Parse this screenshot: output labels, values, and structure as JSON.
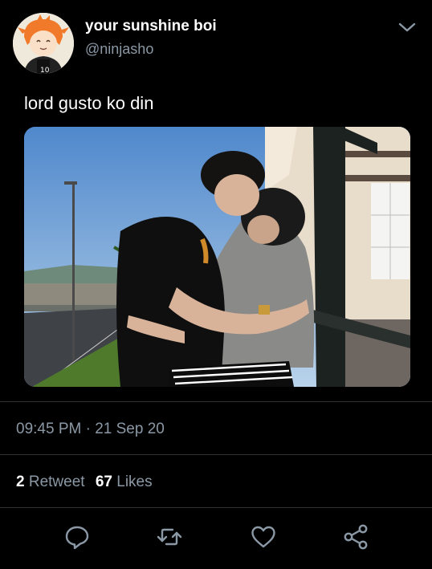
{
  "tweet": {
    "display_name": "your sunshine boi",
    "handle": "@ninjasho",
    "text": "lord gusto ko din",
    "timestamp": "09:45 PM · 21 Sep 20",
    "retweets": {
      "count": "2",
      "label": "Retweet"
    },
    "likes": {
      "count": "67",
      "label": "Likes"
    }
  },
  "icons": {
    "menu": "chevron-down-icon",
    "reply": "reply-icon",
    "retweet": "retweet-icon",
    "like": "heart-icon",
    "share": "share-icon"
  },
  "colors": {
    "background": "#000000",
    "text_primary": "#ffffff",
    "text_secondary": "#8b98a5",
    "divider": "#2f3336"
  }
}
